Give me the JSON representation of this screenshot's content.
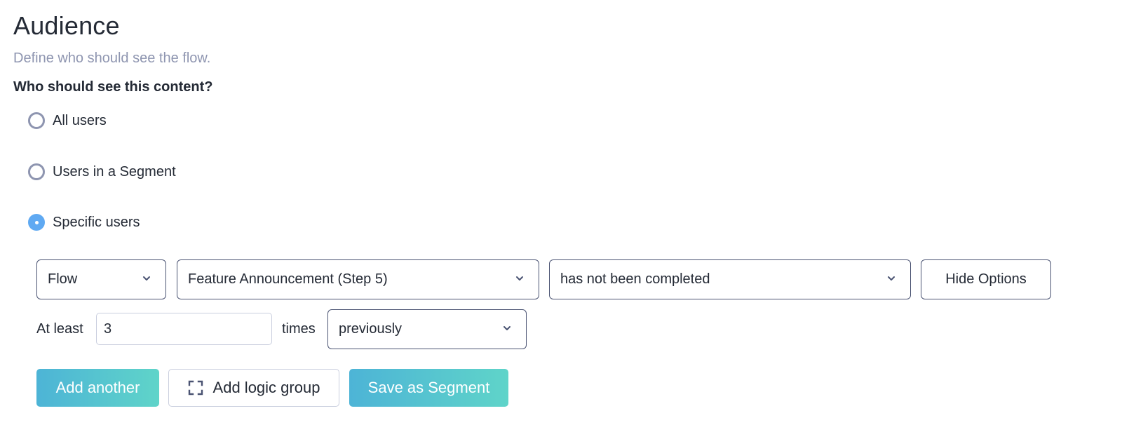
{
  "header": {
    "title": "Audience",
    "subtitle": "Define who should see the flow."
  },
  "audience": {
    "question": "Who should see this content?",
    "options": [
      {
        "label": "All users",
        "checked": false
      },
      {
        "label": "Users in a Segment",
        "checked": false
      },
      {
        "label": "Specific users",
        "checked": true
      }
    ]
  },
  "condition": {
    "property_select": "Flow",
    "flow_select": "Feature Announcement (Step 5)",
    "status_select": "has not been completed",
    "hide_options_label": "Hide Options",
    "at_least_label": "At least",
    "count_value": "3",
    "times_label": "times",
    "timeframe_select": "previously"
  },
  "actions": {
    "add_another_label": "Add another",
    "add_logic_group_label": "Add logic group",
    "save_segment_label": "Save as Segment"
  },
  "icons": {
    "chevron": "chevron-down-icon",
    "logic_group": "expand-brackets-icon"
  },
  "colors": {
    "accent_radio": "#5fa9f2",
    "primary_gradient_start": "#4db4d6",
    "primary_gradient_end": "#5fd4c9",
    "muted_text": "#8e95b0",
    "border_dark": "#4a5372"
  }
}
